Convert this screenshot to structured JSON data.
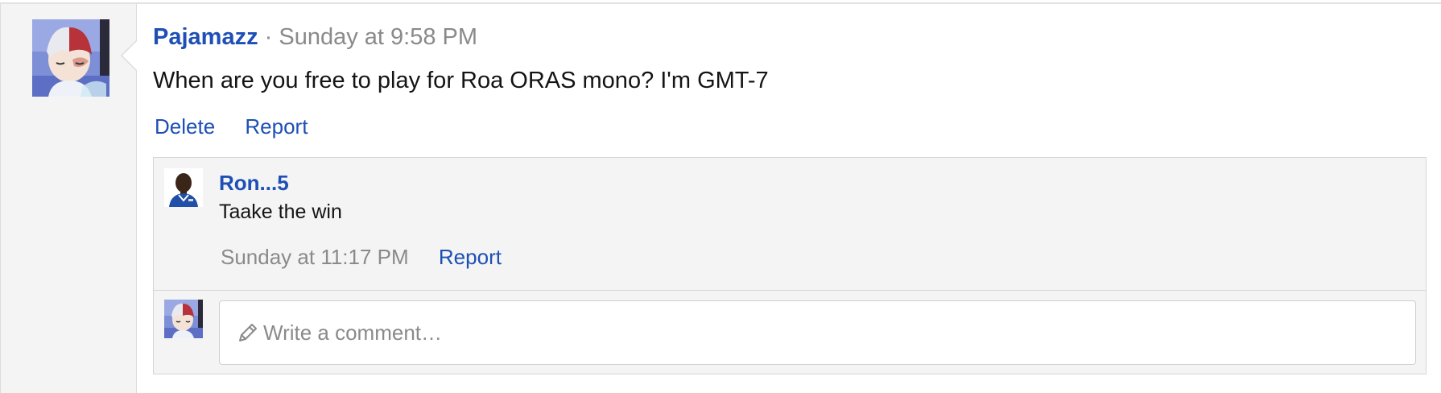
{
  "post": {
    "author": "Pajamazz",
    "separator": "·",
    "time": "Sunday at 9:58 PM",
    "text": "When are you free to play for Roa ORAS mono? I'm GMT-7",
    "actions": {
      "delete_label": "Delete",
      "report_label": "Report"
    },
    "avatar_icon": "anime-character-avatar"
  },
  "reply": {
    "author": "Ron...5",
    "text": "Taake the win",
    "time": "Sunday at 11:17 PM",
    "report_label": "Report",
    "avatar_icon": "player-photo-avatar"
  },
  "composer": {
    "placeholder": "Write a comment…",
    "icon": "pencil-icon"
  },
  "colors": {
    "link": "#1d4fb5",
    "muted": "#8a8a8a",
    "panel_bg": "#f4f4f4",
    "border": "#d6d6d6"
  }
}
